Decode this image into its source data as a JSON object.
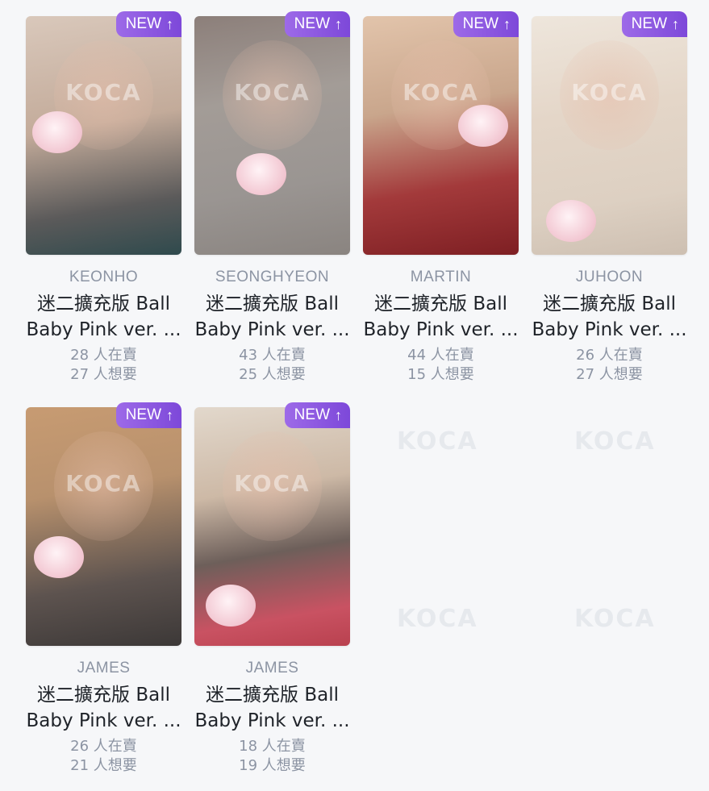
{
  "badge": {
    "label": "NEW",
    "icon": "arrow-up-icon"
  },
  "cards": [
    {
      "member": "KEONHO",
      "title_line1": "迷二擴充版 Ball",
      "title_line2": "Baby Pink ver. ...",
      "selling": "28 人在賣",
      "wanting": "27 人想要",
      "colors": [
        "#c9b7aa",
        "#6e6c6a"
      ]
    },
    {
      "member": "SEONGHYEON",
      "title_line1": "迷二擴充版 Ball",
      "title_line2": "Baby Pink ver. ...",
      "selling": "43 人在賣",
      "wanting": "25 人想要",
      "colors": [
        "#a59e98",
        "#8b8683"
      ]
    },
    {
      "member": "MARTIN",
      "title_line1": "迷二擴充版 Ball",
      "title_line2": "Baby Pink ver. ...",
      "selling": "44 人在賣",
      "wanting": "15 人想要",
      "colors": [
        "#d7b79d",
        "#9c2a2c"
      ]
    },
    {
      "member": "JUHOON",
      "title_line1": "迷二擴充版 Ball",
      "title_line2": "Baby Pink ver. ...",
      "selling": "26 人在賣",
      "wanting": "27 人想要",
      "colors": [
        "#e8ddd2",
        "#d9cfc4"
      ]
    },
    {
      "member": "JAMES",
      "title_line1": "迷二擴充版 Ball",
      "title_line2": "Baby Pink ver. ...",
      "selling": "26 人在賣",
      "wanting": "21 人想要",
      "colors": [
        "#b98d66",
        "#4a4443"
      ]
    },
    {
      "member": "JAMES",
      "title_line1": "迷二擴充版 Ball",
      "title_line2": "Baby Pink ver. ...",
      "selling": "18 人在賣",
      "wanting": "19 人想要",
      "colors": [
        "#cfc4b8",
        "#c9515f"
      ]
    }
  ],
  "watermark": "KOCA"
}
